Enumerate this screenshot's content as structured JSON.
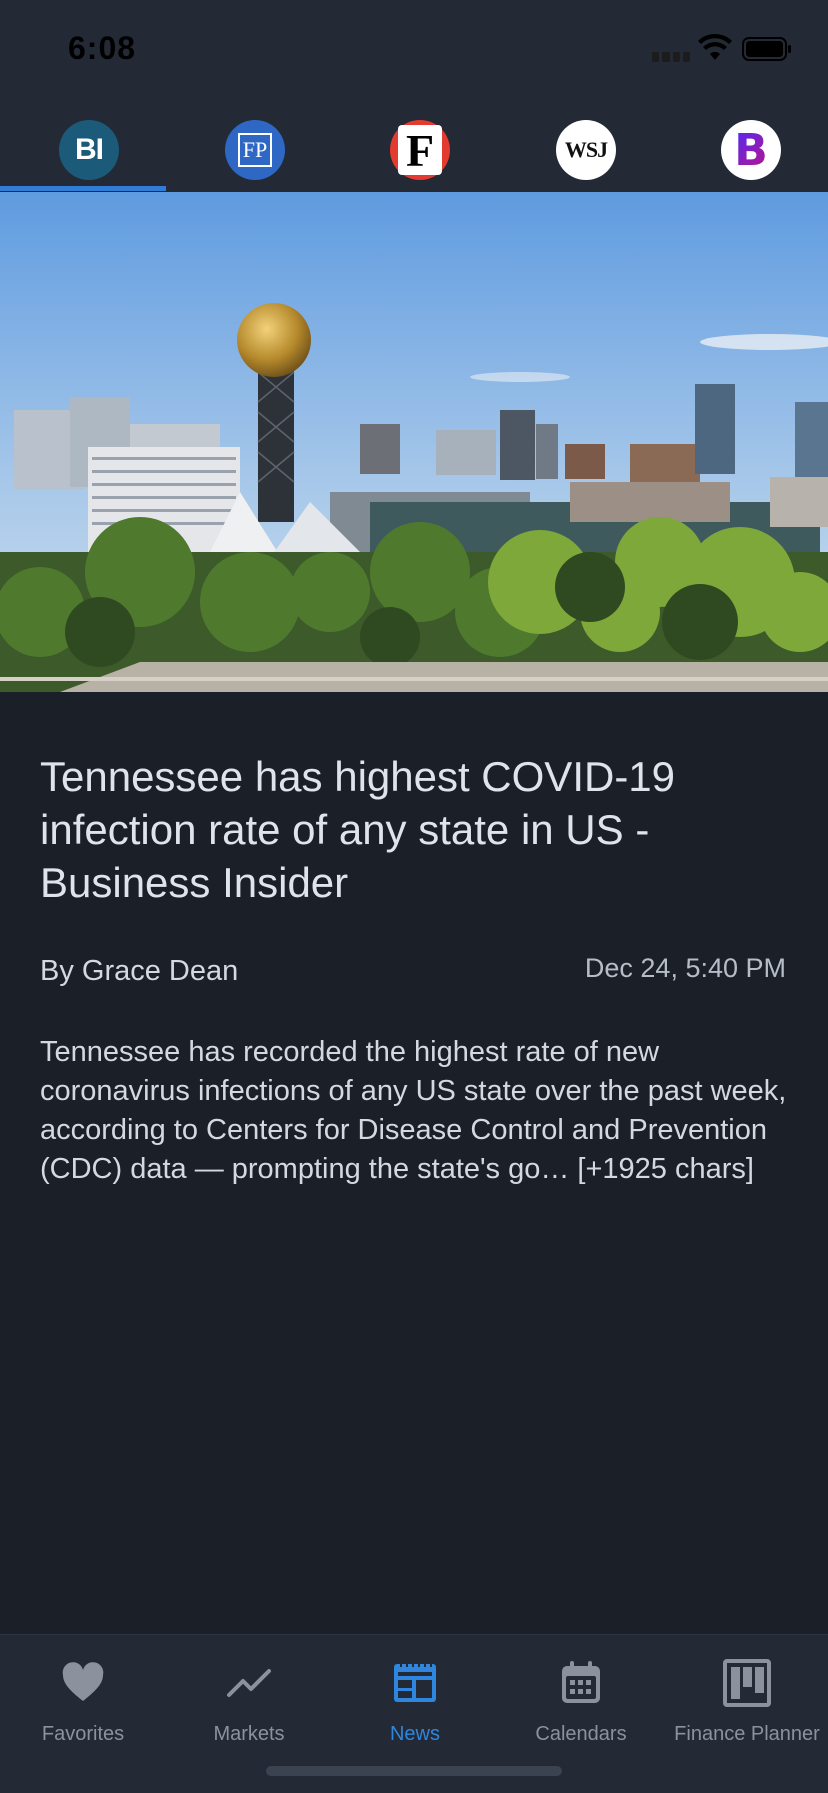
{
  "status_bar": {
    "time": "6:08"
  },
  "sources": [
    {
      "name": "Business Insider",
      "logo_text": "BI"
    },
    {
      "name": "Financial Post",
      "logo_text": "FP"
    },
    {
      "name": "Forbes",
      "logo_text": "F"
    },
    {
      "name": "Wall Street Journal",
      "logo_text": "WSJ"
    },
    {
      "name": "Bloomberg",
      "logo_text": "B"
    }
  ],
  "article": {
    "title": "Tennessee has highest COVID-19 infection rate of any state in US - Business Insider",
    "author": "By Grace Dean",
    "date": "Dec 24, 5:40 PM",
    "body": "Tennessee has recorded the highest rate of new coronavirus infections of any US state over the past week, according to Centers for Disease Control and Prevention (CDC) data — prompting the state's go… [+1925 chars]"
  },
  "tabs": [
    {
      "label": "Favorites",
      "icon": "heart-icon"
    },
    {
      "label": "Markets",
      "icon": "trend-line-icon"
    },
    {
      "label": "News",
      "icon": "newspaper-icon"
    },
    {
      "label": "Calendars",
      "icon": "calendar-icon"
    },
    {
      "label": "Finance Planner",
      "icon": "kanban-icon"
    }
  ],
  "active_tab": "News",
  "colors": {
    "accent": "#2e86de",
    "background": "#1b1f28",
    "bar": "#232a35"
  }
}
